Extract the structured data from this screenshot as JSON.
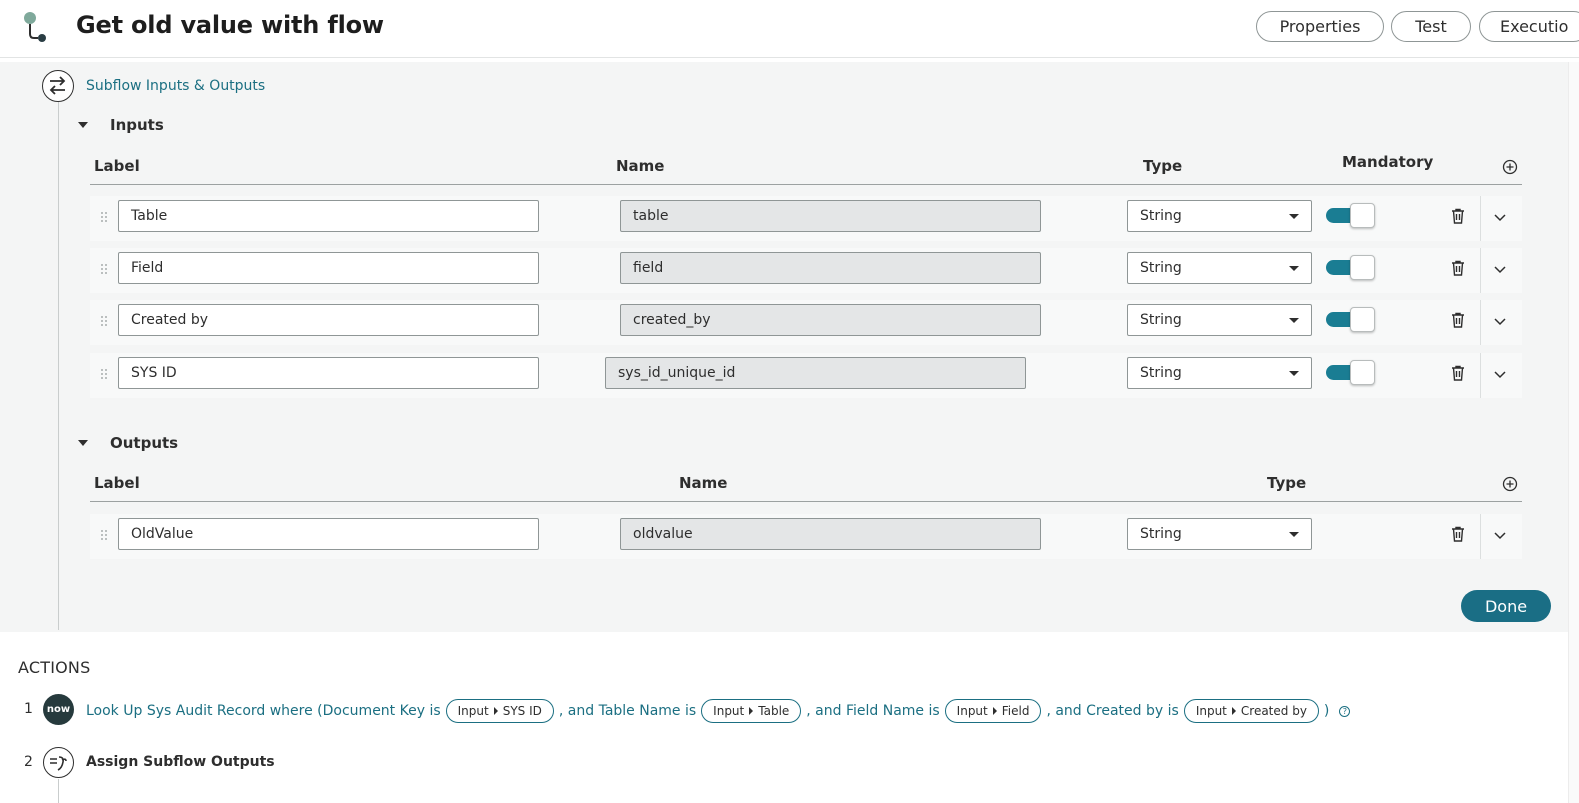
{
  "header": {
    "title": "Get old value with flow",
    "buttons": {
      "properties": "Properties",
      "test": "Test",
      "executions": "Executio"
    }
  },
  "panel": {
    "section_link": "Subflow Inputs & Outputs",
    "inputs": {
      "title": "Inputs",
      "columns": {
        "label": "Label",
        "name": "Name",
        "type": "Type",
        "mandatory": "Mandatory"
      },
      "rows": [
        {
          "label": "Table",
          "name": "table",
          "type": "String",
          "mandatory": true
        },
        {
          "label": "Field",
          "name": "field",
          "type": "String",
          "mandatory": true
        },
        {
          "label": "Created by",
          "name": "created_by",
          "type": "String",
          "mandatory": true
        },
        {
          "label": "SYS ID",
          "name": "sys_id_unique_id",
          "type": "String",
          "mandatory": true
        }
      ]
    },
    "outputs": {
      "title": "Outputs",
      "columns": {
        "label": "Label",
        "name": "Name",
        "type": "Type"
      },
      "rows": [
        {
          "label": "OldValue",
          "name": "oldvalue",
          "type": "String"
        }
      ]
    },
    "done_label": "Done"
  },
  "actions": {
    "title": "ACTIONS",
    "items": [
      {
        "number": "1",
        "badge": "now",
        "text_parts": [
          "Look Up Sys Audit Record where (Document Key is",
          ", and Table Name is",
          ", and Field Name is",
          ", and Created by is",
          ")"
        ],
        "pills": [
          {
            "source": "Input",
            "field": "SYS ID"
          },
          {
            "source": "Input",
            "field": "Table"
          },
          {
            "source": "Input",
            "field": "Field"
          },
          {
            "source": "Input",
            "field": "Created by"
          }
        ],
        "help": "?"
      },
      {
        "number": "2",
        "label": "Assign Subflow Outputs"
      }
    ]
  },
  "colors": {
    "accent": "#1a6e85",
    "link": "#1b6f82",
    "toggle_on": "#1a7d93",
    "panel_bg": "#f4f5f5"
  },
  "icons": [
    "flow-logo-icon",
    "swap-arrows-icon",
    "caret-down-icon",
    "add-circle-icon",
    "drag-handle-icon",
    "trash-icon",
    "chevron-down-icon",
    "help-icon",
    "assign-outputs-icon"
  ]
}
